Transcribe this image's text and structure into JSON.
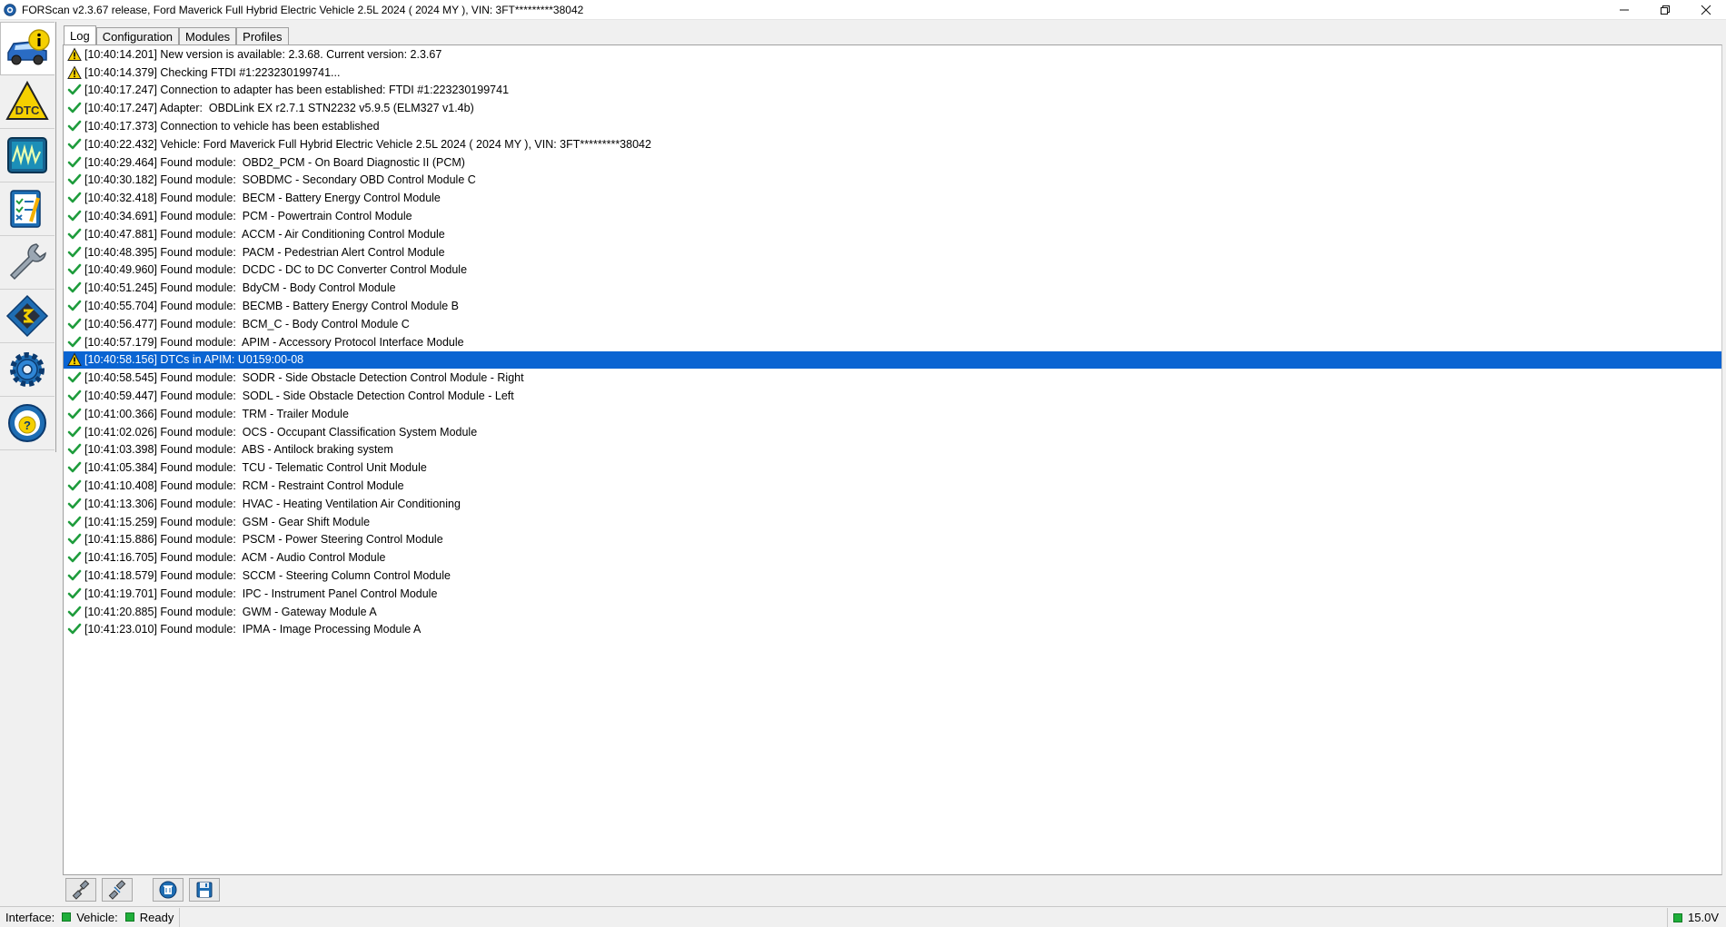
{
  "window": {
    "title": "FORScan v2.3.67 release, Ford Maverick Full Hybrid Electric Vehicle 2.5L 2024 ( 2024 MY ), VIN: 3FT*********38042",
    "controls": [
      "minimize",
      "restore",
      "close"
    ]
  },
  "sidebar": {
    "items": [
      {
        "name": "vehicle-info",
        "icon": "car-info-icon",
        "active": true
      },
      {
        "name": "dtc",
        "icon": "dtc-warning-icon",
        "label": "DTC"
      },
      {
        "name": "oscilloscope",
        "icon": "oscilloscope-icon"
      },
      {
        "name": "tests",
        "icon": "checklist-icon"
      },
      {
        "name": "service",
        "icon": "wrench-icon"
      },
      {
        "name": "configuration",
        "icon": "chip-icon"
      },
      {
        "name": "settings",
        "icon": "gear-icon"
      },
      {
        "name": "help",
        "icon": "help-icon"
      }
    ]
  },
  "tabs": [
    {
      "label": "Log",
      "active": true
    },
    {
      "label": "Configuration"
    },
    {
      "label": "Modules"
    },
    {
      "label": "Profiles"
    }
  ],
  "log": {
    "selected_index": 17,
    "lines": [
      {
        "type": "warning",
        "text": "[10:40:14.201] New version is available: 2.3.68. Current version: 2.3.67"
      },
      {
        "type": "warning",
        "text": "[10:40:14.379] Checking FTDI #1:223230199741..."
      },
      {
        "type": "ok",
        "text": "[10:40:17.247] Connection to adapter has been established: FTDI #1:223230199741"
      },
      {
        "type": "ok",
        "text": "[10:40:17.247] Adapter:  OBDLink EX r2.7.1 STN2232 v5.9.5 (ELM327 v1.4b)"
      },
      {
        "type": "ok",
        "text": "[10:40:17.373] Connection to vehicle has been established"
      },
      {
        "type": "ok",
        "text": "[10:40:22.432] Vehicle: Ford Maverick Full Hybrid Electric Vehicle 2.5L 2024 ( 2024 MY ), VIN: 3FT*********38042"
      },
      {
        "type": "ok",
        "text": "[10:40:29.464] Found module:  OBD2_PCM - On Board Diagnostic II (PCM)"
      },
      {
        "type": "ok",
        "text": "[10:40:30.182] Found module:  SOBDMC - Secondary OBD Control Module C"
      },
      {
        "type": "ok",
        "text": "[10:40:32.418] Found module:  BECM - Battery Energy Control Module"
      },
      {
        "type": "ok",
        "text": "[10:40:34.691] Found module:  PCM - Powertrain Control Module"
      },
      {
        "type": "ok",
        "text": "[10:40:47.881] Found module:  ACCM - Air Conditioning Control Module"
      },
      {
        "type": "ok",
        "text": "[10:40:48.395] Found module:  PACM - Pedestrian Alert Control Module"
      },
      {
        "type": "ok",
        "text": "[10:40:49.960] Found module:  DCDC - DC to DC Converter Control Module"
      },
      {
        "type": "ok",
        "text": "[10:40:51.245] Found module:  BdyCM - Body Control Module"
      },
      {
        "type": "ok",
        "text": "[10:40:55.704] Found module:  BECMB - Battery Energy Control Module B"
      },
      {
        "type": "ok",
        "text": "[10:40:56.477] Found module:  BCM_C - Body Control Module C"
      },
      {
        "type": "ok",
        "text": "[10:40:57.179] Found module:  APIM - Accessory Protocol Interface Module"
      },
      {
        "type": "warning",
        "text": "[10:40:58.156] DTCs in APIM: U0159:00-08"
      },
      {
        "type": "ok",
        "text": "[10:40:58.545] Found module:  SODR - Side Obstacle Detection Control Module - Right"
      },
      {
        "type": "ok",
        "text": "[10:40:59.447] Found module:  SODL - Side Obstacle Detection Control Module - Left"
      },
      {
        "type": "ok",
        "text": "[10:41:00.366] Found module:  TRM - Trailer Module"
      },
      {
        "type": "ok",
        "text": "[10:41:02.026] Found module:  OCS - Occupant Classification System Module"
      },
      {
        "type": "ok",
        "text": "[10:41:03.398] Found module:  ABS - Antilock braking system"
      },
      {
        "type": "ok",
        "text": "[10:41:05.384] Found module:  TCU - Telematic Control Unit Module"
      },
      {
        "type": "ok",
        "text": "[10:41:10.408] Found module:  RCM - Restraint Control Module"
      },
      {
        "type": "ok",
        "text": "[10:41:13.306] Found module:  HVAC - Heating Ventilation Air Conditioning"
      },
      {
        "type": "ok",
        "text": "[10:41:15.259] Found module:  GSM - Gear Shift Module"
      },
      {
        "type": "ok",
        "text": "[10:41:15.886] Found module:  PSCM - Power Steering Control Module"
      },
      {
        "type": "ok",
        "text": "[10:41:16.705] Found module:  ACM - Audio Control Module"
      },
      {
        "type": "ok",
        "text": "[10:41:18.579] Found module:  SCCM - Steering Column Control Module"
      },
      {
        "type": "ok",
        "text": "[10:41:19.701] Found module:  IPC - Instrument Panel Control Module"
      },
      {
        "type": "ok",
        "text": "[10:41:20.885] Found module:  GWM - Gateway Module A"
      },
      {
        "type": "ok",
        "text": "[10:41:23.010] Found module:  IPMA - Image Processing Module A"
      }
    ]
  },
  "toolbar": {
    "buttons": [
      "connect-icon",
      "disconnect-icon",
      "clear-log-icon",
      "save-log-icon"
    ]
  },
  "status": {
    "interface_label": "Interface:",
    "vehicle_label": "Vehicle:",
    "state": "Ready",
    "voltage": "15.0V",
    "led_color": "#1fae3a"
  },
  "colors": {
    "selection": "#0a64d2",
    "ok_check": "#1e9c3c",
    "warning_fill": "#f5d000"
  }
}
